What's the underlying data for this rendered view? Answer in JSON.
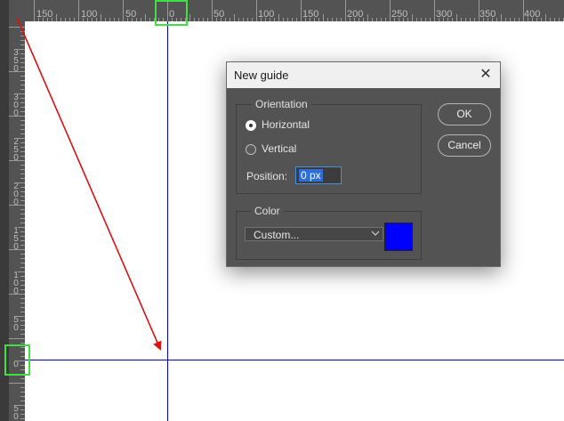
{
  "ruler": {
    "horizontal_ticks": [
      "150",
      "100",
      "50",
      "0",
      "50",
      "100",
      "150",
      "200",
      "250",
      "300",
      "350",
      "400"
    ],
    "vertical_ticks": [
      "350",
      "300",
      "250",
      "200",
      "150",
      "100",
      "50",
      "0",
      "50"
    ]
  },
  "guides": {
    "color": "#0000cc"
  },
  "highlight": {
    "color": "#3ee23e"
  },
  "annotation": {
    "arrow_color": "#dd1111"
  },
  "dialog": {
    "title": "New guide",
    "close_glyph": "✕",
    "orientation_group": {
      "legend": "Orientation",
      "options": [
        {
          "label": "Horizontal",
          "checked": true
        },
        {
          "label": "Vertical",
          "checked": false
        }
      ],
      "position_label": "Position:",
      "position_value": "0 px"
    },
    "color_group": {
      "legend": "Color",
      "selected": "Custom...",
      "dropdown_icon": "chevron-down-icon",
      "swatch_color": "#0000ff"
    },
    "buttons": {
      "ok": "OK",
      "cancel": "Cancel"
    }
  }
}
